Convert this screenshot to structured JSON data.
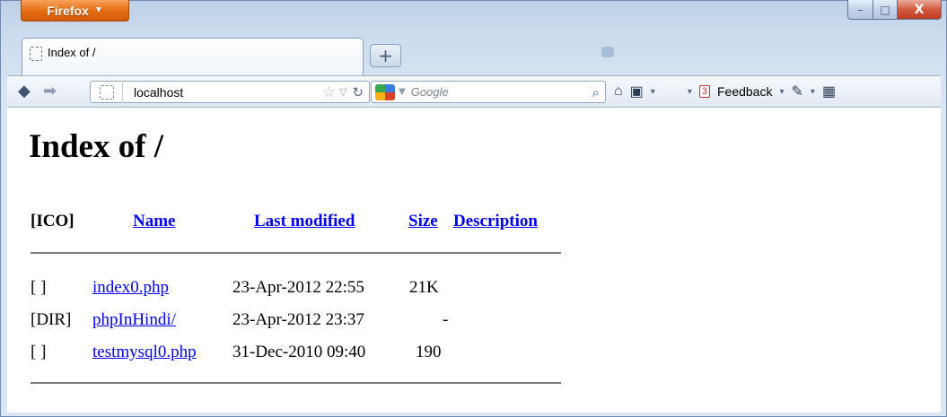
{
  "window": {
    "app_button_label": "Firefox",
    "caption": {
      "minimize": "–",
      "maximize": "□",
      "close": "X"
    }
  },
  "tabs": [
    {
      "label": "Index of /"
    }
  ],
  "new_tab_label": "+",
  "navbar": {
    "url": "localhost",
    "search_placeholder": "Google",
    "feedback_label": "Feedback",
    "badge_count": "3"
  },
  "page": {
    "title": "Index of /",
    "columns": {
      "icon": "[ICO]",
      "name": "Name",
      "last_modified": "Last modified",
      "size": "Size",
      "description": "Description"
    },
    "rows": [
      {
        "icon": "[ ]",
        "name": "index0.php",
        "modified": "23-Apr-2012 22:55",
        "size": "21K",
        "description": ""
      },
      {
        "icon": "[DIR]",
        "name": "phpInHindi/",
        "modified": "23-Apr-2012 23:37",
        "size": "-",
        "description": ""
      },
      {
        "icon": "[ ]",
        "name": "testmysql0.php",
        "modified": "31-Dec-2010 09:40",
        "size": "190",
        "description": ""
      }
    ]
  },
  "colors": {
    "link": "#0000ee",
    "firefox_button": "#e26c12",
    "close_button": "#c03a1f"
  }
}
